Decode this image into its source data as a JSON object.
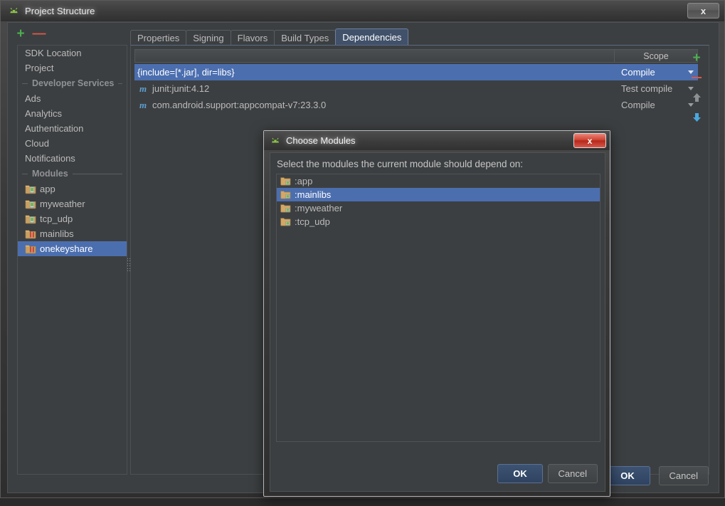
{
  "main_window": {
    "title": "Project Structure",
    "title_icon": "android-studio-icon",
    "close_label": "x",
    "toolbar": {
      "add_label": "+",
      "remove_label": "—"
    },
    "sidebar": {
      "items": [
        {
          "label": "SDK Location",
          "type": "item",
          "selected": false
        },
        {
          "label": "Project",
          "type": "item",
          "selected": false
        },
        {
          "label": "Developer Services",
          "type": "separator"
        },
        {
          "label": "Ads",
          "type": "item",
          "selected": false
        },
        {
          "label": "Analytics",
          "type": "item",
          "selected": false
        },
        {
          "label": "Authentication",
          "type": "item",
          "selected": false
        },
        {
          "label": "Cloud",
          "type": "item",
          "selected": false
        },
        {
          "label": "Notifications",
          "type": "item",
          "selected": false
        },
        {
          "label": "Modules",
          "type": "separator"
        },
        {
          "label": "app",
          "type": "module",
          "icon": "android-module-icon",
          "selected": false
        },
        {
          "label": "myweather",
          "type": "module",
          "icon": "android-module-icon",
          "selected": false
        },
        {
          "label": "tcp_udp",
          "type": "module",
          "icon": "android-module-icon",
          "selected": false
        },
        {
          "label": "mainlibs",
          "type": "module",
          "icon": "android-library-icon",
          "selected": false
        },
        {
          "label": "onekeyshare",
          "type": "module",
          "icon": "android-library-icon",
          "selected": true
        }
      ]
    },
    "tabs": [
      {
        "label": "Properties",
        "active": false
      },
      {
        "label": "Signing",
        "active": false
      },
      {
        "label": "Flavors",
        "active": false
      },
      {
        "label": "Build Types",
        "active": false
      },
      {
        "label": "Dependencies",
        "active": true
      }
    ],
    "dependencies_table": {
      "columns": [
        "",
        "Scope"
      ],
      "rows": [
        {
          "name": "{include=[*.jar], dir=libs}",
          "icon": "",
          "scope": "Compile",
          "selected": true
        },
        {
          "name": "junit:junit:4.12",
          "icon": "maven-icon",
          "scope": "Test compile",
          "selected": false
        },
        {
          "name": "com.android.support:appcompat-v7:23.3.0",
          "icon": "maven-icon",
          "scope": "Compile",
          "selected": false
        }
      ]
    },
    "right_toolbar": [
      {
        "name": "add-dependency-icon",
        "glyph": "+",
        "color": "#4caf50",
        "enabled": true
      },
      {
        "name": "remove-dependency-icon",
        "glyph": "—",
        "color": "#d9584a",
        "enabled": true
      },
      {
        "name": "move-up-icon",
        "glyph": "▲",
        "color": "#8d9093",
        "enabled": false
      },
      {
        "name": "move-down-icon",
        "glyph": "▼",
        "color": "#4aa8e0",
        "enabled": true
      }
    ],
    "buttons": {
      "ok": "OK",
      "cancel": "Cancel"
    }
  },
  "dialog": {
    "title": "Choose Modules",
    "title_icon": "android-studio-icon",
    "close_label": "x",
    "prompt": "Select the modules the current module should depend on:",
    "modules": [
      {
        "label": ":app",
        "icon": "module-folder-icon",
        "selected": false
      },
      {
        "label": ":mainlibs",
        "icon": "module-folder-icon",
        "selected": true
      },
      {
        "label": ":myweather",
        "icon": "module-folder-icon",
        "selected": false
      },
      {
        "label": ":tcp_udp",
        "icon": "module-folder-icon",
        "selected": false
      }
    ],
    "buttons": {
      "ok": "OK",
      "cancel": "Cancel"
    }
  },
  "colors": {
    "selection_blue": "#4b6eaf",
    "panel_bg": "#3c3f41",
    "accent_green": "#4caf50",
    "accent_red": "#d9584a",
    "accent_blue": "#4aa8e0",
    "close_red": "#cf4433"
  }
}
